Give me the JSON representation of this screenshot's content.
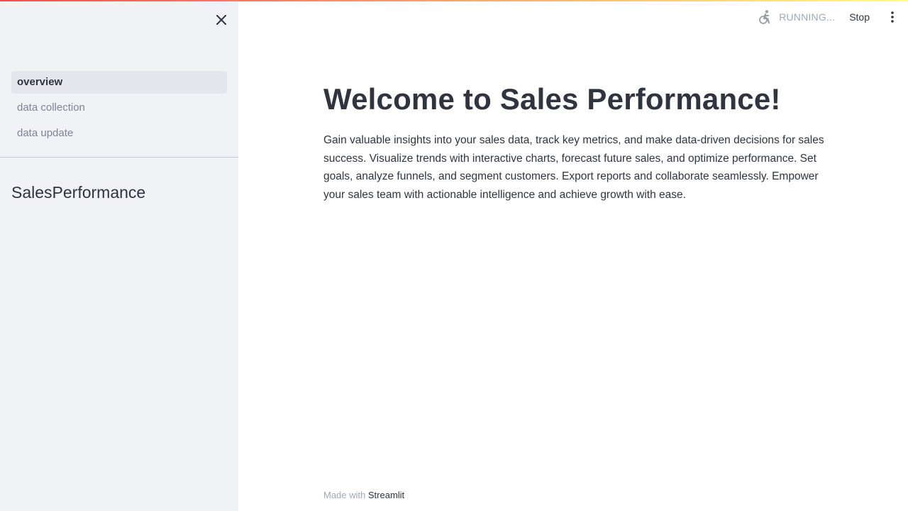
{
  "sidebar": {
    "nav_items": [
      {
        "label": "overview",
        "active": true
      },
      {
        "label": "data collection",
        "active": false
      },
      {
        "label": "data update",
        "active": false
      }
    ],
    "title": "SalesPerformance",
    "close_icon": "close-icon"
  },
  "toolbar": {
    "status_icon": "running-figure-icon",
    "status_text": "RUNNING...",
    "stop_label": "Stop",
    "menu_icon": "kebab-menu-icon"
  },
  "main": {
    "title": "Welcome to Sales Performance!",
    "description": "Gain valuable insights into your sales data, track key metrics, and make data-driven decisions for sales success. Visualize trends with interactive charts, forecast future sales, and optimize performance. Set goals, analyze funnels, and segment customers. Export reports and collaborate seamlessly. Empower your sales team with actionable intelligence and achieve growth with ease."
  },
  "footer": {
    "prefix": "Made with",
    "link": "Streamlit"
  },
  "colors": {
    "accent_start": "#ff4b4b",
    "accent_end": "#fffd80",
    "sidebar_bg": "#f0f2f6",
    "text": "#31333f",
    "muted": "#808495"
  }
}
